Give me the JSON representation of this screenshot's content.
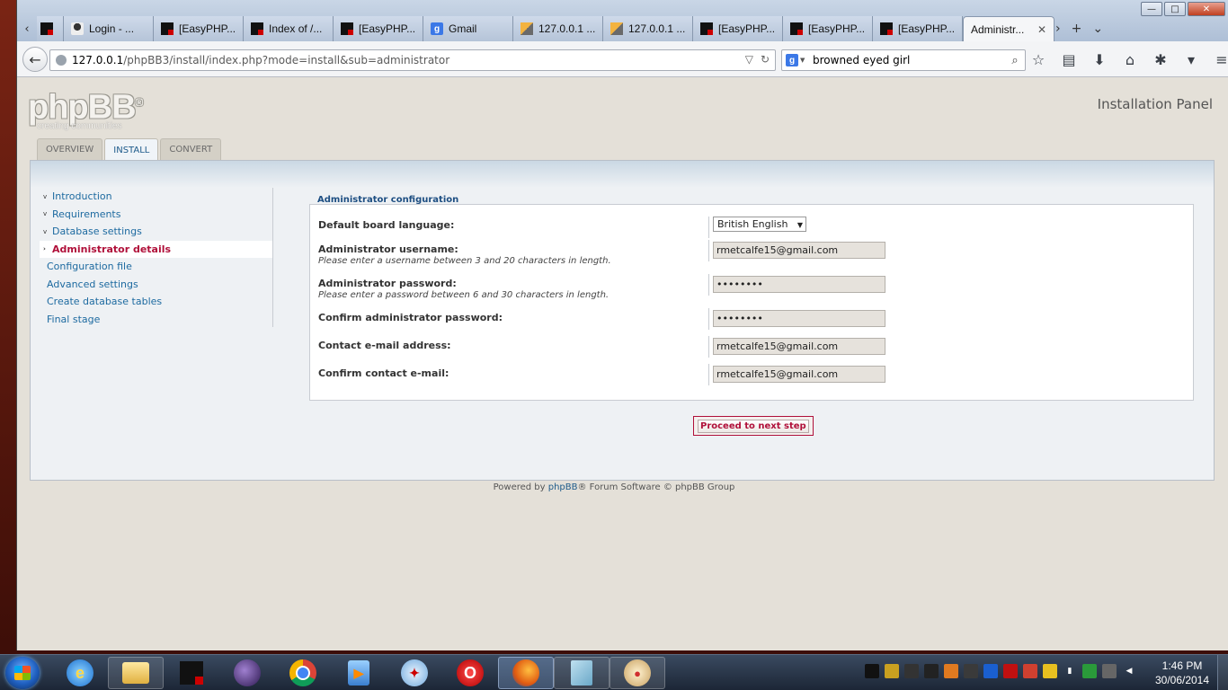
{
  "window_controls": {
    "minimize": "—",
    "maximize": "□",
    "close": "✕"
  },
  "tabs": [
    {
      "label": "",
      "icon": "scroll-left-icon"
    },
    {
      "label": "Login - ...",
      "icon": "login-icon"
    },
    {
      "label": "[EasyPHP...",
      "icon": "easyphp-icon"
    },
    {
      "label": "Index of /...",
      "icon": "easyphp-icon"
    },
    {
      "label": "[EasyPHP...",
      "icon": "easyphp-icon"
    },
    {
      "label": "Gmail",
      "icon": "google-icon"
    },
    {
      "label": "127.0.0.1 ...",
      "icon": "phpmyadmin-icon"
    },
    {
      "label": "127.0.0.1 ...",
      "icon": "phpmyadmin-icon"
    },
    {
      "label": "[EasyPHP...",
      "icon": "easyphp-icon"
    },
    {
      "label": "[EasyPHP...",
      "icon": "easyphp-icon"
    },
    {
      "label": "[EasyPHP...",
      "icon": "easyphp-icon"
    },
    {
      "label": "Administr...",
      "icon": "none",
      "active": true
    }
  ],
  "tab_tools": {
    "scroll_right": "›",
    "new_tab": "+",
    "list_all": "⌄"
  },
  "nav": {
    "back": "←",
    "url_host": "127.0.0.1",
    "url_rest": "/phpBB3/install/index.php?mode=install&sub=administrator",
    "url_dropdown": "▽",
    "reload": "↻",
    "search_engine_letter": "g",
    "search_value": "browned eyed girl",
    "search_go": "⌕",
    "tools": {
      "bookmark": "☆",
      "reading_list": "▤",
      "downloads": "⬇",
      "home": "⌂",
      "addon": "✱",
      "addon_menu": "▾",
      "menu": "≡"
    }
  },
  "page": {
    "logo_main": "phpBB",
    "logo_reg": "®",
    "logo_sub": "creating  communities",
    "panel_title": "Installation Panel",
    "menu_tabs": [
      {
        "label": "OVERVIEW",
        "active": false
      },
      {
        "label": "INSTALL",
        "active": true
      },
      {
        "label": "CONVERT",
        "active": false
      }
    ],
    "sidebar": [
      {
        "label": "Introduction",
        "state": "done"
      },
      {
        "label": "Requirements",
        "state": "done"
      },
      {
        "label": "Database settings",
        "state": "done"
      },
      {
        "label": "Administrator details",
        "state": "current"
      },
      {
        "label": "Configuration file",
        "state": "future"
      },
      {
        "label": "Advanced settings",
        "state": "future"
      },
      {
        "label": "Create database tables",
        "state": "future"
      },
      {
        "label": "Final stage",
        "state": "future"
      }
    ],
    "legend": "Administrator configuration",
    "fields": {
      "language": {
        "label": "Default board language:",
        "value": "British English"
      },
      "username": {
        "label": "Administrator username:",
        "help": "Please enter a username between 3 and 20 characters in length.",
        "value": "rmetcalfe15@gmail.com"
      },
      "password": {
        "label": "Administrator password:",
        "help": "Please enter a password between 6 and 30 characters in length.",
        "value": "••••••••"
      },
      "password_confirm": {
        "label": "Confirm administrator password:",
        "value": "••••••••"
      },
      "email": {
        "label": "Contact e-mail address:",
        "value": "rmetcalfe15@gmail.com"
      },
      "email_confirm": {
        "label": "Confirm contact e-mail:",
        "value": "rmetcalfe15@gmail.com"
      }
    },
    "proceed_label": "Proceed to next step",
    "footer": {
      "prefix": "Powered by ",
      "link": "phpBB",
      "suffix": "® Forum Software © phpBB Group"
    }
  },
  "taskbar": {
    "apps": [
      "internet-explorer",
      "file-explorer",
      "easyphp",
      "eclipse",
      "chrome",
      "media-player",
      "safari",
      "opera",
      "firefox",
      "notepad",
      "paint"
    ],
    "clock_time": "1:46 PM",
    "clock_date": "30/06/2014"
  }
}
